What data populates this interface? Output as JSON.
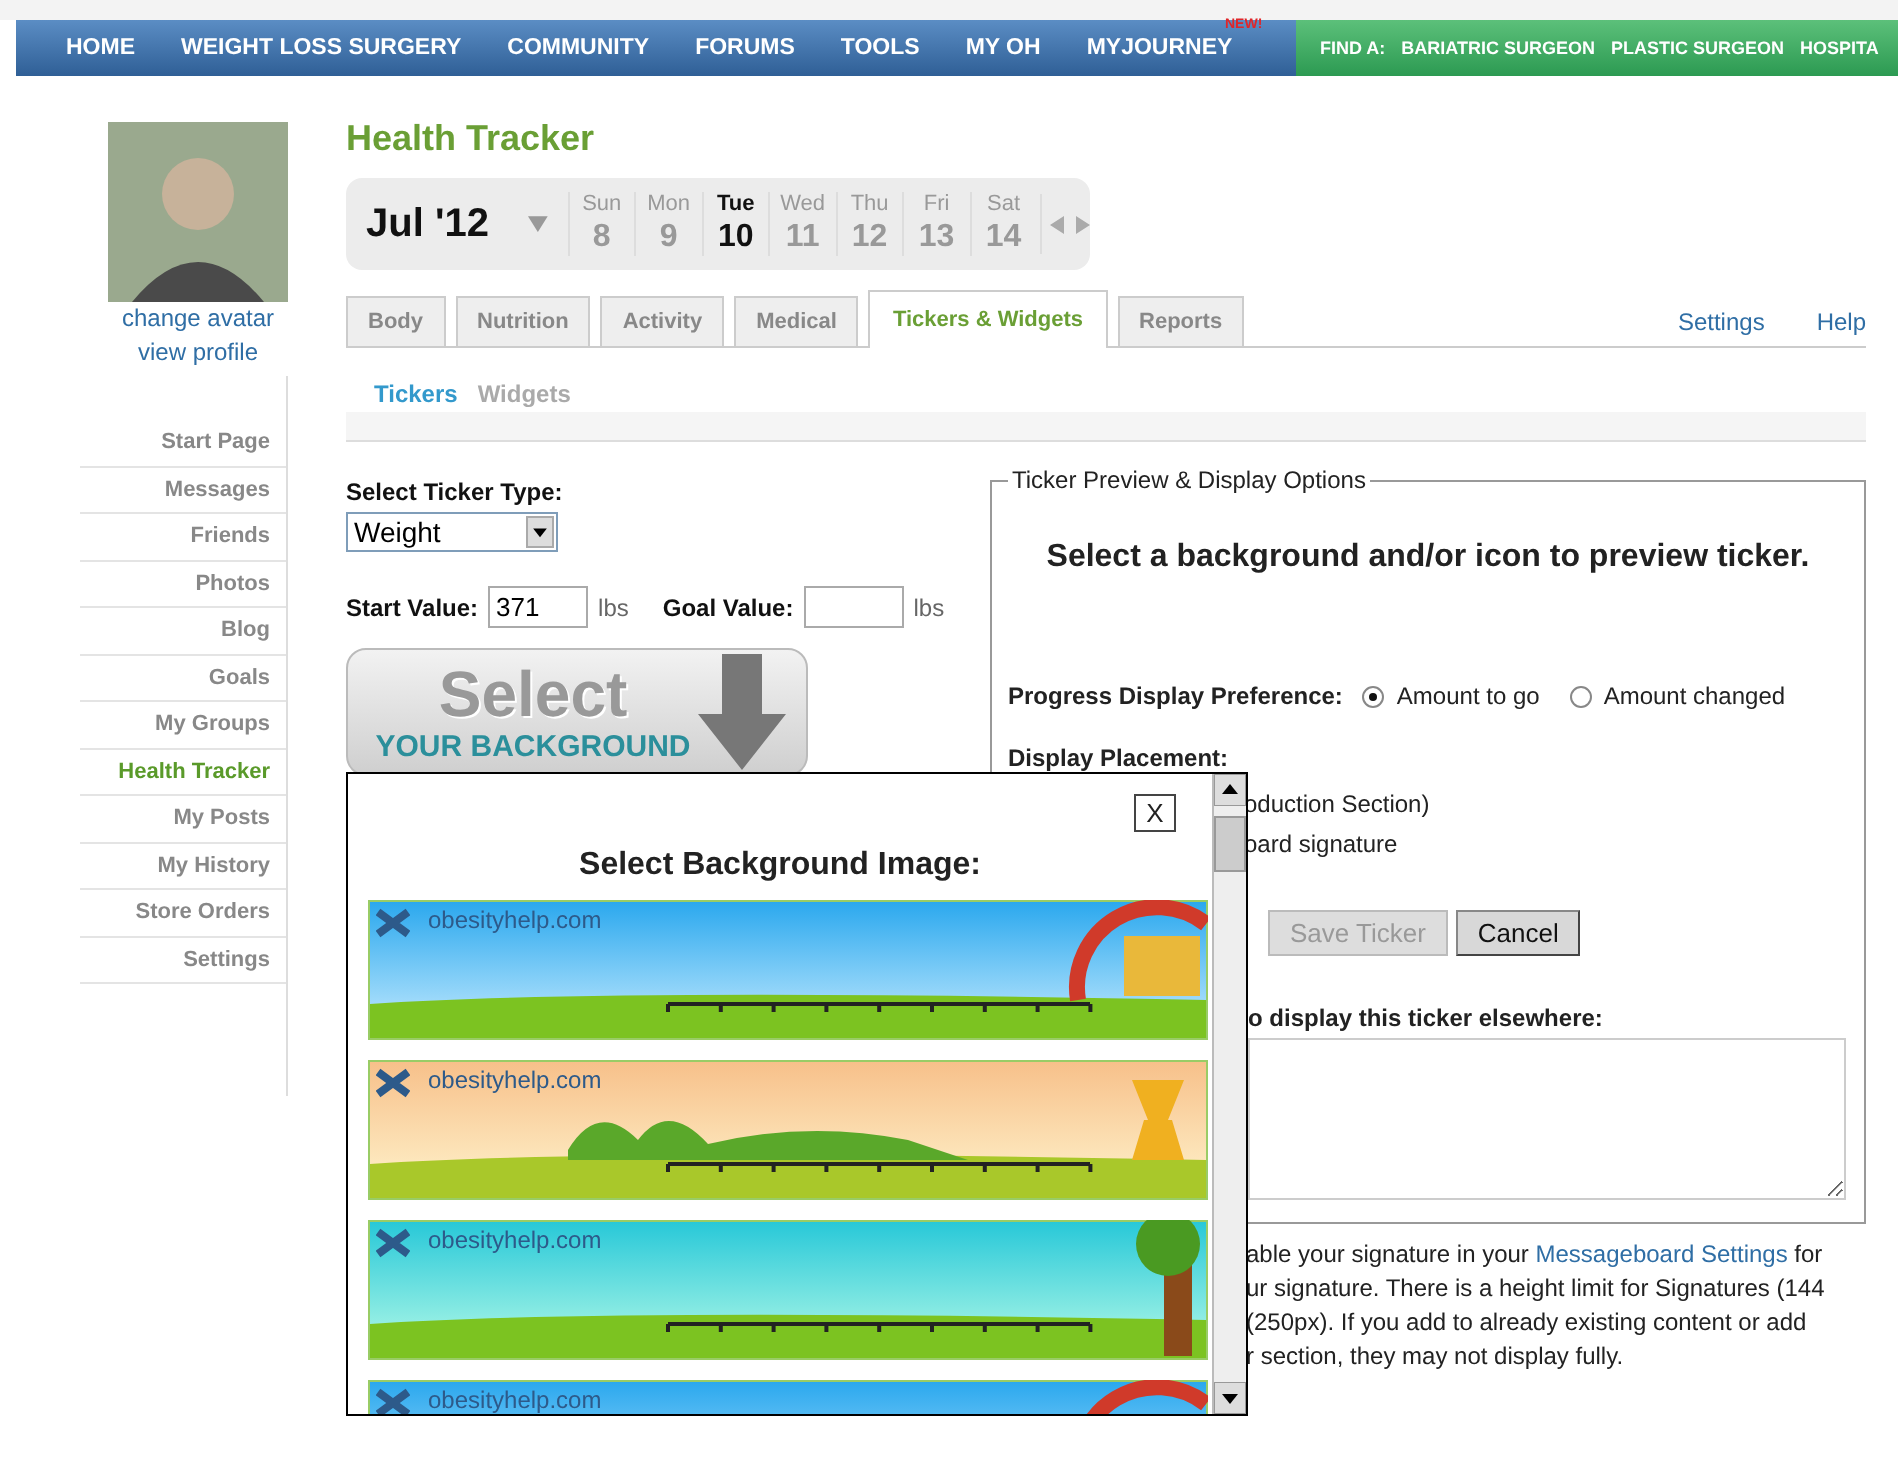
{
  "nav": {
    "items": [
      {
        "label": "HOME"
      },
      {
        "label": "WEIGHT LOSS SURGERY"
      },
      {
        "label": "COMMUNITY"
      },
      {
        "label": "FORUMS"
      },
      {
        "label": "TOOLS"
      },
      {
        "label": "MY OH"
      },
      {
        "label": "MYJOURNEY",
        "badge": "NEW!"
      }
    ],
    "find_label": "FIND A:",
    "find_links": [
      "BARIATRIC SURGEON",
      "PLASTIC SURGEON",
      "HOSPITA"
    ]
  },
  "profile": {
    "links": [
      "change avatar",
      "view profile"
    ]
  },
  "sidebar": {
    "items": [
      {
        "label": "Start Page",
        "selected": false
      },
      {
        "label": "Messages",
        "selected": false
      },
      {
        "label": "Friends",
        "selected": false
      },
      {
        "label": "Photos",
        "selected": false
      },
      {
        "label": "Blog",
        "selected": false
      },
      {
        "label": "Goals",
        "selected": false
      },
      {
        "label": "My Groups",
        "selected": false
      },
      {
        "label": "Health Tracker",
        "selected": true
      },
      {
        "label": "My Posts",
        "selected": false
      },
      {
        "label": "My History",
        "selected": false
      },
      {
        "label": "Store Orders",
        "selected": false
      },
      {
        "label": "Settings",
        "selected": false
      }
    ]
  },
  "title": "Health Tracker",
  "date_bar": {
    "month": "Jul '12",
    "days": [
      {
        "day": "Sun",
        "date": "8",
        "selected": false
      },
      {
        "day": "Mon",
        "date": "9",
        "selected": false
      },
      {
        "day": "Tue",
        "date": "10",
        "selected": true
      },
      {
        "day": "Wed",
        "date": "11",
        "selected": false
      },
      {
        "day": "Thu",
        "date": "12",
        "selected": false
      },
      {
        "day": "Fri",
        "date": "13",
        "selected": false
      },
      {
        "day": "Sat",
        "date": "14",
        "selected": false
      }
    ]
  },
  "tabs": [
    {
      "label": "Body",
      "selected": false
    },
    {
      "label": "Nutrition",
      "selected": false
    },
    {
      "label": "Activity",
      "selected": false
    },
    {
      "label": "Medical",
      "selected": false
    },
    {
      "label": "Tickers & Widgets",
      "selected": true
    },
    {
      "label": "Reports",
      "selected": false
    }
  ],
  "header_links": [
    "Settings",
    "Help"
  ],
  "subtabs": [
    {
      "label": "Tickers",
      "selected": true
    },
    {
      "label": "Widgets",
      "selected": false
    }
  ],
  "ticker_form": {
    "type_label": "Select Ticker Type:",
    "type_value": "Weight",
    "start_label": "Start Value:",
    "start_value": "371",
    "start_unit": "lbs",
    "goal_label": "Goal Value:",
    "goal_unit": "lbs",
    "select_button": {
      "line_1": "Select",
      "line_2": "YOUR BACKGROUND"
    }
  },
  "preview": {
    "legend": "Ticker Preview & Display Options",
    "heading": "Select a background and/or icon to preview ticker.",
    "progress_label": "Progress Display Preference:",
    "progress_options": [
      {
        "label": "Amount to go",
        "selected": true
      },
      {
        "label": "Amount changed",
        "selected": false
      }
    ],
    "placement_label": "Display Placement:",
    "placement_options": [
      "oduction Section)",
      "oard signature"
    ],
    "buttons": [
      {
        "label": "Save Ticker",
        "disabled": true
      },
      {
        "label": "Cancel",
        "disabled": false
      }
    ],
    "code_label": "o display this ticker elsewhere:",
    "note_lines": [
      {
        "before": "able your signature in your ",
        "link": "Messageboard Settings",
        "after": " for"
      },
      {
        "before": "ur signature. There is a height limit for Signatures (144"
      },
      {
        "before": "(250px). If you add to already existing content or add"
      },
      {
        "before": "r section, they may not display fully."
      }
    ]
  },
  "modal": {
    "close": "X",
    "title": "Select Background Image:",
    "backgrounds": [
      {
        "kind": "rainbow",
        "brand": "obesityhelp.com"
      },
      {
        "kind": "trophy",
        "brand": "obesityhelp.com"
      },
      {
        "kind": "tree",
        "brand": "obesityhelp.com"
      },
      {
        "kind": "rainbow",
        "brand": "obesityhelp.com"
      }
    ]
  }
}
